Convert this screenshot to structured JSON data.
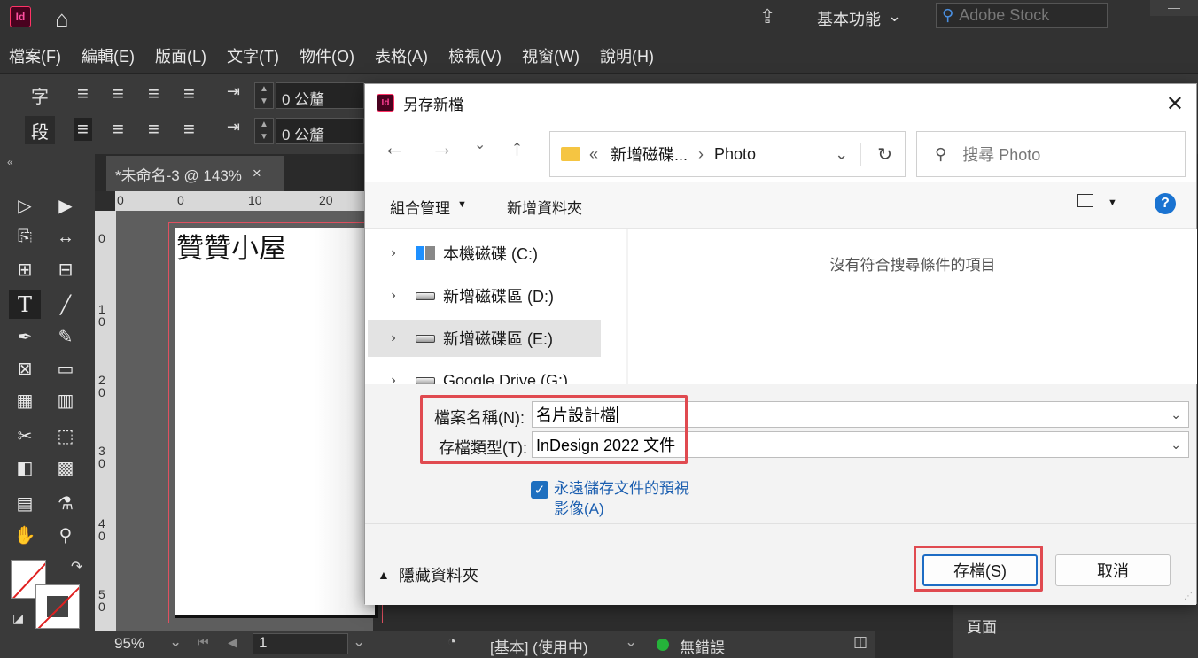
{
  "app": {
    "logo_text": "Id",
    "workspace": "基本功能",
    "stock_search_placeholder": "Adobe Stock"
  },
  "menu": [
    "檔案(F)",
    "編輯(E)",
    "版面(L)",
    "文字(T)",
    "物件(O)",
    "表格(A)",
    "檢視(V)",
    "視窗(W)",
    "說明(H)"
  ],
  "control_panel": {
    "char_label": "字",
    "para_label": "段",
    "indent_left": "0 公釐",
    "indent_first": "0 公釐"
  },
  "document": {
    "tab_title": "*未命名-3 @ 143%",
    "tab_close": "×",
    "page_text": "贊贊小屋",
    "ruler_h": [
      "0",
      "0",
      "10",
      "20"
    ],
    "ruler_v": [
      "0",
      "1\n0",
      "2\n0",
      "3\n0",
      "4\n0",
      "5\n0"
    ]
  },
  "status": {
    "zoom": "95%",
    "page": "1",
    "preflight_profile": "[基本] (使用中)",
    "errors": "無錯誤"
  },
  "right_panel": {
    "pages_label": "頁面"
  },
  "dialog": {
    "title": "另存新檔",
    "address": {
      "prefix": "«",
      "parent": "新增磁碟...",
      "separator": "›",
      "current": "Photo"
    },
    "search_placeholder": "搜尋 Photo",
    "organize": "組合管理",
    "new_folder": "新增資料夾",
    "help": "?",
    "tree": [
      {
        "label": "本機磁碟 (C:)",
        "selected": false
      },
      {
        "label": "新增磁碟區 (D:)",
        "selected": false
      },
      {
        "label": "新增磁碟區 (E:)",
        "selected": true
      },
      {
        "label": "Google Drive (G:)",
        "selected": false
      }
    ],
    "empty_message": "沒有符合搜尋條件的項目",
    "filename_label": "檔案名稱(N):",
    "filename_value": "名片設計檔",
    "filetype_label": "存檔類型(T):",
    "filetype_value": "InDesign 2022 文件",
    "preview_checkbox_line1": "永遠儲存文件的預視",
    "preview_checkbox_line2": "影像(A)",
    "preview_checked": true,
    "hide_folders": "隱藏資料夾",
    "save_button": "存檔(S)",
    "cancel_button": "取消"
  },
  "colors": {
    "highlight_box": "#e04a50",
    "accent_blue": "#1d6cc4",
    "app_dark": "#323232"
  }
}
